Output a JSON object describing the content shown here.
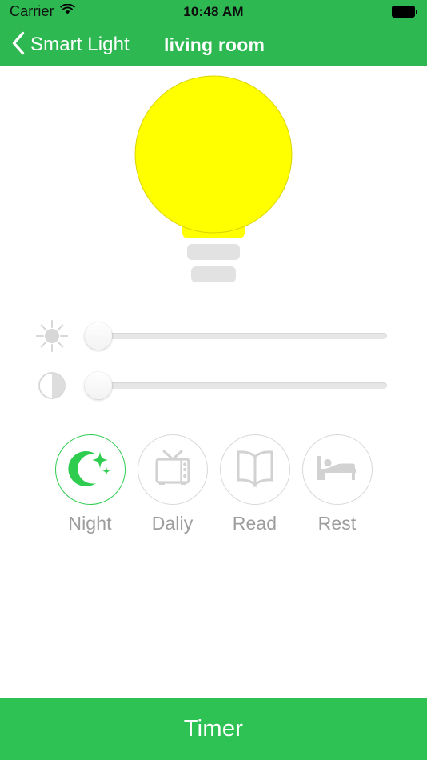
{
  "status_bar": {
    "carrier": "Carrier",
    "wifi_icon": "wifi-icon",
    "time": "10:48 AM",
    "battery_icon": "battery-full-icon"
  },
  "nav_bar": {
    "back_icon": "chevron-left-icon",
    "back_label": "Smart Light",
    "title": "living room"
  },
  "bulb": {
    "icon": "light-bulb-icon",
    "glass_color": "#FFFF00",
    "base_color": "#e2e2e2",
    "state": "on"
  },
  "sliders": [
    {
      "name": "brightness",
      "icon": "sun-icon",
      "value": 0,
      "min": 0,
      "max": 100
    },
    {
      "name": "contrast",
      "icon": "contrast-icon",
      "value": 0,
      "min": 0,
      "max": 100
    }
  ],
  "modes": [
    {
      "label": "Night",
      "icon": "moon-stars-icon",
      "active": true
    },
    {
      "label": "Daliy",
      "icon": "tv-icon",
      "active": false
    },
    {
      "label": "Read",
      "icon": "open-book-icon",
      "active": false
    },
    {
      "label": "Rest",
      "icon": "bed-icon",
      "active": false
    }
  ],
  "bottom_bar": {
    "timer_label": "Timer"
  },
  "colors": {
    "brand_green": "#2eb852",
    "active_green": "#2ecc4f",
    "bulb_yellow": "#FFFF00",
    "icon_gray": "#cfcfcf",
    "label_gray": "#9d9d9d",
    "track_gray": "#e6e6e6"
  }
}
